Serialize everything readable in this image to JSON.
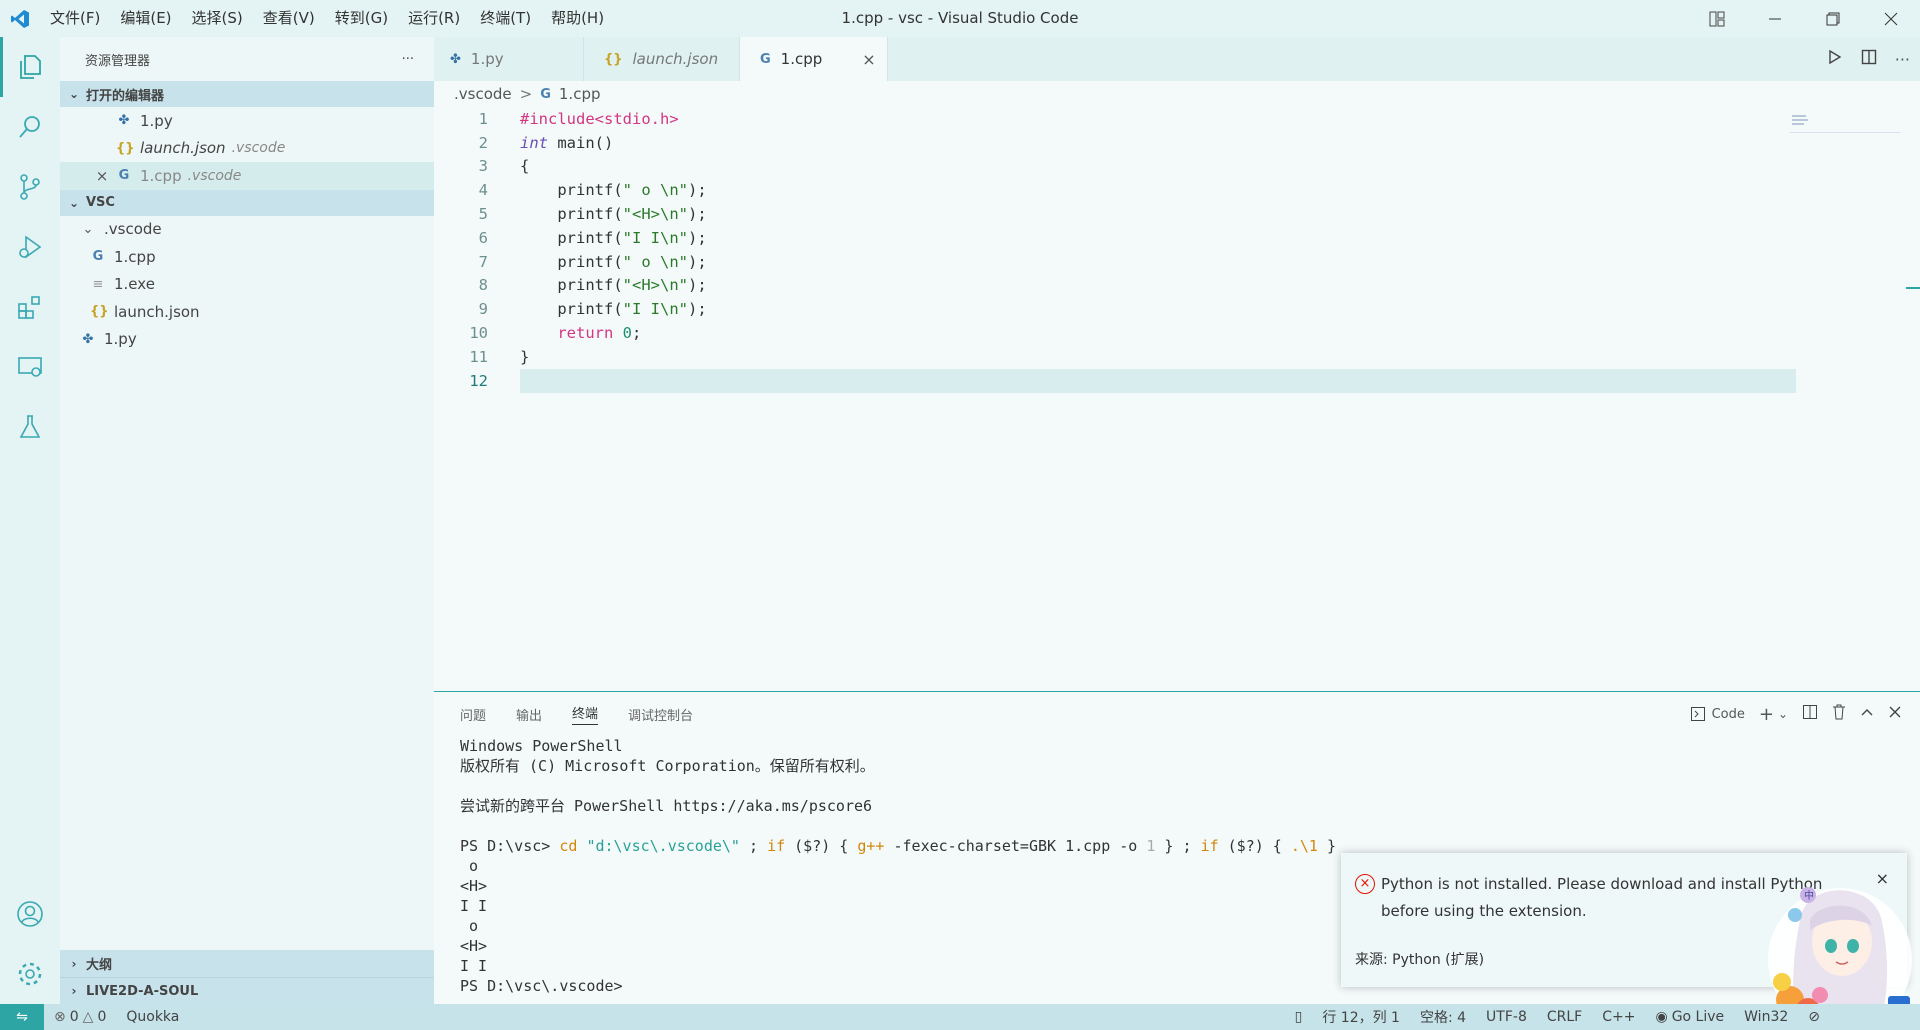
{
  "window": {
    "title": "1.cpp - vsc - Visual Studio Code",
    "menu": [
      "文件(F)",
      "编辑(E)",
      "选择(S)",
      "查看(V)",
      "转到(G)",
      "运行(R)",
      "终端(T)",
      "帮助(H)"
    ]
  },
  "sidebar": {
    "title": "资源管理器",
    "more": "···",
    "open_editors": {
      "header": "打开的编辑器",
      "items": [
        {
          "icon": "✤",
          "name": "1.py",
          "hint": ""
        },
        {
          "icon": "{}",
          "name": "launch.json",
          "hint": ".vscode"
        },
        {
          "icon": "G",
          "name": "1.cpp",
          "hint": ".vscode",
          "close": "×"
        }
      ]
    },
    "folder": {
      "header": "VSC",
      "items": [
        {
          "icon": "⌄",
          "name": ".vscode"
        },
        {
          "icon": "G",
          "name": "1.cpp"
        },
        {
          "icon": "≡",
          "name": "1.exe"
        },
        {
          "icon": "{}",
          "name": "launch.json"
        },
        {
          "icon": "✤",
          "name": "1.py"
        }
      ]
    },
    "outline": "大纲",
    "live2d": "LIVE2D-A-SOUL"
  },
  "tabs": [
    {
      "icon": "✤",
      "label": "1.py"
    },
    {
      "icon": "{}",
      "label": "launch.json"
    },
    {
      "icon": "G",
      "label": "1.cpp",
      "close": "×"
    }
  ],
  "breadcrumb": {
    "folder": ".vscode",
    "file": "1.cpp",
    "sep": ">"
  },
  "code": {
    "line_numbers": [
      "1",
      "2",
      "3",
      "4",
      "5",
      "6",
      "7",
      "8",
      "9",
      "10",
      "11",
      "12"
    ],
    "l1_inc": "#include",
    "l1_hdr": "<stdio.h>",
    "l2_kw": "int",
    "l2_rest": " main()",
    "l3": "{",
    "printf": "printf",
    "s4": "\" o \\n\"",
    "s5": "\"<H>\\n\"",
    "s6": "\"I I\\n\"",
    "s7": "\" o \\n\"",
    "s8": "\"<H>\\n\"",
    "s9": "\"I I\\n\"",
    "l10_kw": "return",
    "l10_num": "0",
    "l11": "}"
  },
  "panel": {
    "tabs": [
      "问题",
      "输出",
      "终端",
      "调试控制台"
    ],
    "terminal_name": "Code",
    "terminal": {
      "l1": "Windows PowerShell",
      "l2": "版权所有 (C) Microsoft Corporation。保留所有权利。",
      "l3": "尝试新的跨平台 PowerShell https://aka.ms/pscore6",
      "prompt": "PS D:\\vsc> ",
      "cd": "cd",
      "cdpath": "\"d:\\vsc\\.vscode\\\"",
      "semi1": " ; ",
      "if1": "if",
      "cond1": " ($?) { ",
      "gpp": "g++",
      "gargs": " -fexec-charset=GBK 1.cpp -o ",
      "out1": "1",
      "close1": " } ; ",
      "if2": "if",
      "cond2": " ($?) { ",
      "run": ".\\1",
      "close2": " }",
      "output": [
        " o",
        "<H>",
        "I I",
        " o",
        "<H>",
        "I I"
      ],
      "final_prompt": "PS D:\\vsc\\.vscode>"
    }
  },
  "notification": {
    "message": "Python is not installed. Please download and install Python before using the extension.",
    "source": "来源: Python (扩展)"
  },
  "statusbar": {
    "errors": "0",
    "warnings": "0",
    "quokka": "Quokka",
    "position": "行 12，列 1",
    "spaces": "空格: 4",
    "encoding": "UTF-8",
    "eol": "CRLF",
    "language": "C++",
    "golive": "Go Live",
    "platform": "Win32"
  },
  "colors": {
    "accent": "#2ea5a5",
    "error": "#e51400"
  }
}
